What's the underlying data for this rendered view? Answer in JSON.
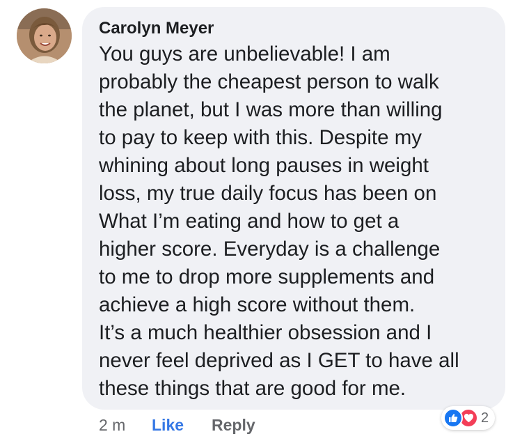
{
  "comment": {
    "author": "Carolyn Meyer",
    "lines": [
      "You guys are unbelievable!  I am",
      "probably the cheapest person to walk",
      "the planet, but I was more than willing",
      "to pay to keep with this.  Despite my",
      "whining about long pauses in weight",
      "loss, my true daily focus has been on",
      "What I’m eating and how to get a",
      "higher score.  Everyday is a challenge",
      "to me to drop more supplements and",
      "achieve a high score without them.",
      "It’s a much healthier obsession and I",
      "never feel deprived as I GET to have all",
      "these things that are good for me."
    ],
    "bubble_color": "#f0f1f5"
  },
  "actions": {
    "time": "2 m",
    "like_label": "Like",
    "reply_label": "Reply",
    "like_color": "#3578e5"
  },
  "reactions": {
    "icons": [
      "thumbs-up-icon",
      "heart-icon"
    ],
    "count": "2",
    "like_color": "#1877f2",
    "love_color": "#f33e58"
  }
}
